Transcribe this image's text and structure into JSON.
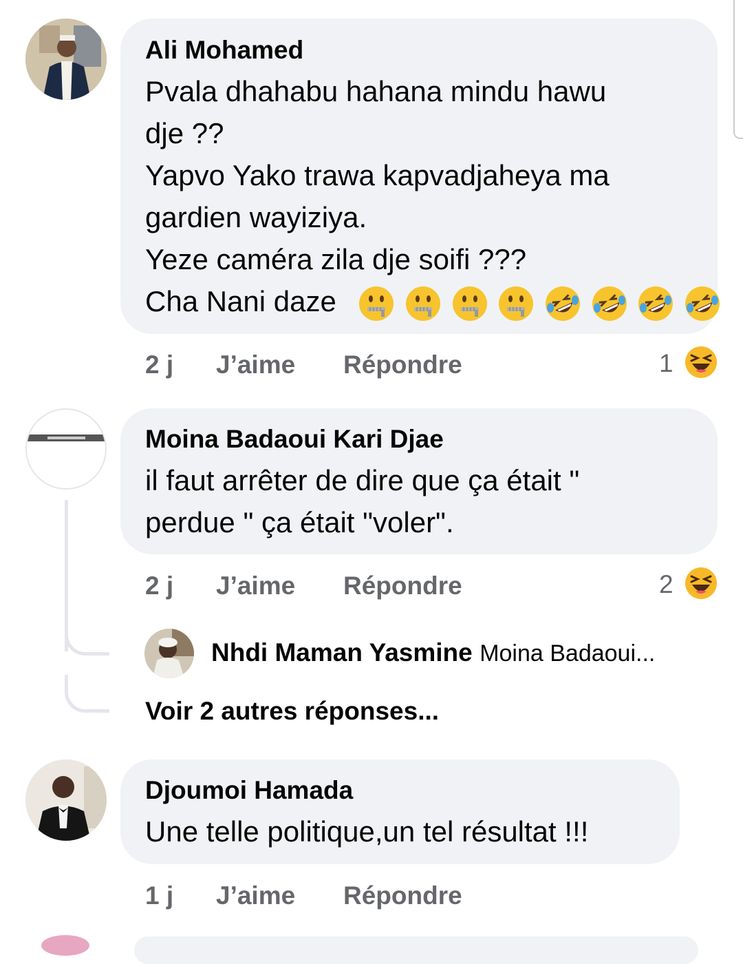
{
  "comments": [
    {
      "author": "Ali Mohamed",
      "lines": [
        "Pvala dhahabu hahana mindu hawu",
        "dje ??",
        "Yapvo Yako trawa kapvadjaheya ma",
        "gardien wayiziya.",
        "Yeze caméra zila dje soifi ???",
        "Cha Nani daze"
      ],
      "emojis": [
        "zipper-mouth-face",
        "zipper-mouth-face",
        "zipper-mouth-face",
        "zipper-mouth-face",
        "rolling-on-floor-laughing",
        "rolling-on-floor-laughing",
        "rolling-on-floor-laughing",
        "rolling-on-floor-laughing"
      ],
      "time": "2 j",
      "like": "J’aime",
      "reply": "Répondre",
      "reactions": "1",
      "reaction_icon": "haha-icon"
    },
    {
      "author": "Moina Badaoui Kari Djae",
      "lines": [
        "il faut arrêter de dire que ça était \"",
        "perdue \" ça était \"voler\"."
      ],
      "time": "2 j",
      "like": "J’aime",
      "reply": "Répondre",
      "reactions": "2",
      "reaction_icon": "haha-icon",
      "reply_preview": {
        "author": "Nhdi Maman Yasmine",
        "snippet": "Moina Badaoui..."
      },
      "more_replies": "Voir 2 autres réponses..."
    },
    {
      "author": "Djoumoi Hamada",
      "lines": [
        "Une telle politique,un tel résultat !!!"
      ],
      "time": "1 j",
      "like": "J’aime",
      "reply": "Répondre"
    }
  ],
  "colors": {
    "bubble": "#f0f2f5",
    "meta_text": "#65676b",
    "haha_yellow": "#f7b928"
  }
}
